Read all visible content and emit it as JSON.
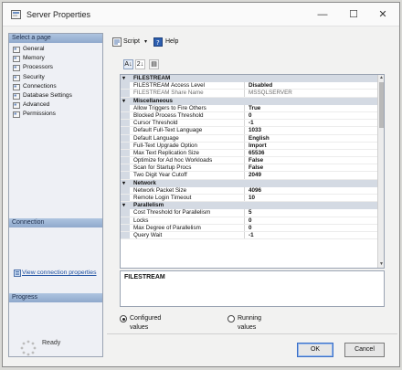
{
  "window": {
    "title": "Server Properties",
    "controls": [
      "—",
      "☐",
      "✕"
    ]
  },
  "left": {
    "select_page_header": "Select a page",
    "pages": [
      "General",
      "Memory",
      "Processors",
      "Security",
      "Connections",
      "Database Settings",
      "Advanced",
      "Permissions"
    ],
    "connection_header": "Connection",
    "view_connection_link": "View connection properties",
    "progress_header": "Progress",
    "progress_status": "Ready"
  },
  "toolbar": {
    "script_label": "Script",
    "help_label": "Help",
    "sort_az": "A↓",
    "sort_cat": "2↓"
  },
  "grid": {
    "rows": [
      {
        "type": "cat",
        "name": "FILESTREAM"
      },
      {
        "type": "prop",
        "name": "FILESTREAM Access Level",
        "value": "Disabled"
      },
      {
        "type": "readonly",
        "name": "FILESTREAM Share Name",
        "value": "MSSQLSERVER"
      },
      {
        "type": "cat",
        "name": "Miscellaneous"
      },
      {
        "type": "prop",
        "name": "Allow Triggers to Fire Others",
        "value": "True"
      },
      {
        "type": "prop",
        "name": "Blocked Process Threshold",
        "value": "0"
      },
      {
        "type": "prop",
        "name": "Cursor Threshold",
        "value": "-1"
      },
      {
        "type": "prop",
        "name": "Default Full-Text Language",
        "value": "1033"
      },
      {
        "type": "prop",
        "name": "Default Language",
        "value": "English"
      },
      {
        "type": "prop",
        "name": "Full-Text Upgrade Option",
        "value": "Import"
      },
      {
        "type": "prop",
        "name": "Max Text Replication Size",
        "value": "65536"
      },
      {
        "type": "prop",
        "name": "Optimize for Ad hoc Workloads",
        "value": "False"
      },
      {
        "type": "prop",
        "name": "Scan for Startup Procs",
        "value": "False"
      },
      {
        "type": "prop",
        "name": "Two Digit Year Cutoff",
        "value": "2049"
      },
      {
        "type": "cat",
        "name": "Network"
      },
      {
        "type": "prop",
        "name": "Network Packet Size",
        "value": "4096"
      },
      {
        "type": "prop",
        "name": "Remote Login Timeout",
        "value": "10"
      },
      {
        "type": "cat",
        "name": "Parallelism"
      },
      {
        "type": "prop",
        "name": "Cost Threshold for Parallelism",
        "value": "5"
      },
      {
        "type": "prop",
        "name": "Locks",
        "value": "0"
      },
      {
        "type": "prop",
        "name": "Max Degree of Parallelism",
        "value": "0"
      },
      {
        "type": "prop",
        "name": "Query Wait",
        "value": "-1"
      }
    ]
  },
  "description": {
    "title": "FILESTREAM"
  },
  "options": {
    "configured_label": "Configured values",
    "running_label": "Running values",
    "selected": "configured"
  },
  "buttons": {
    "ok": "OK",
    "cancel": "Cancel"
  },
  "colors": {
    "section_header": "#8fa9cc",
    "category_row": "#d4dae3",
    "link": "#1c4fa0"
  }
}
